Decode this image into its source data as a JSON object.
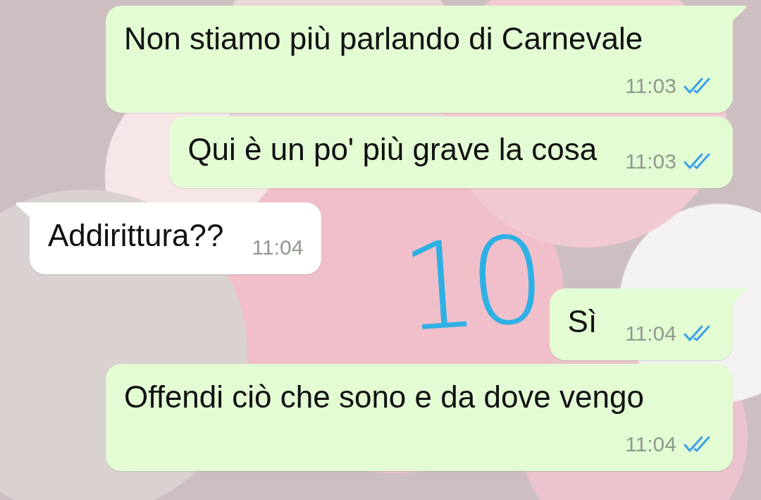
{
  "messages": [
    {
      "kind": "outgoing",
      "tail": true,
      "text": "Non stiamo più parlando di Carnevale",
      "time": "11:03",
      "read": true
    },
    {
      "kind": "outgoing",
      "tail": false,
      "text": "Qui è un po' più grave la cosa",
      "time": "11:03",
      "read": true
    },
    {
      "kind": "incoming",
      "tail": true,
      "text": "Addirittura??",
      "time": "11:04"
    },
    {
      "kind": "outgoing",
      "tail": true,
      "text": "Sì",
      "time": "11:04",
      "read": true
    },
    {
      "kind": "outgoing",
      "tail": false,
      "text": "Offendi ciò che sono e da dove vengo",
      "time": "11:04",
      "read": true
    }
  ],
  "annotation": "10"
}
